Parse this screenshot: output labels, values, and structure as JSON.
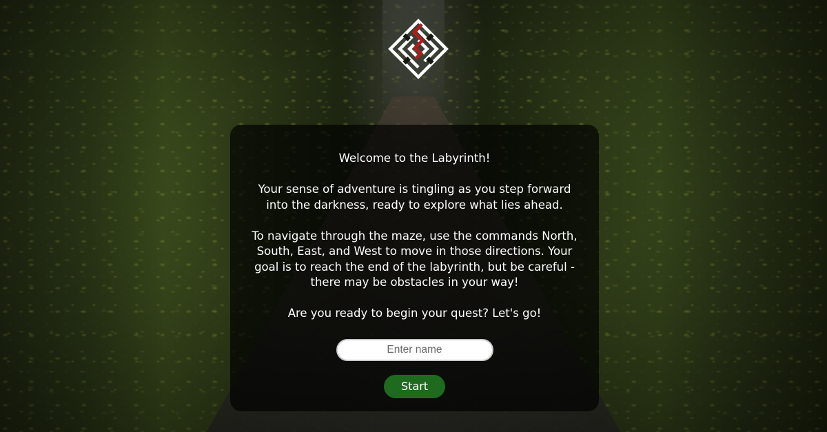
{
  "logo": {
    "icon": "maze-icon",
    "colors": {
      "lines": "#ffffff",
      "accent": "#b31b1b"
    }
  },
  "intro": {
    "welcome": "Welcome to the Labyrinth!",
    "adventure": "Your sense of adventure is tingling as you step forward into the darkness, ready to explore what lies ahead.",
    "instructions": "To navigate through the maze, use the commands North, South, East, and West to move in those directions. Your goal is to reach the end of the labyrinth, but be careful - there may be obstacles in your way!",
    "ready": "Are you ready to begin your quest? Let's go!"
  },
  "form": {
    "name_placeholder": "Enter name",
    "name_value": "",
    "start_label": "Start"
  },
  "colors": {
    "panel_bg": "rgba(0,0,0,0.68)",
    "button_bg": "#1e6b1f",
    "text": "#ffffff"
  }
}
